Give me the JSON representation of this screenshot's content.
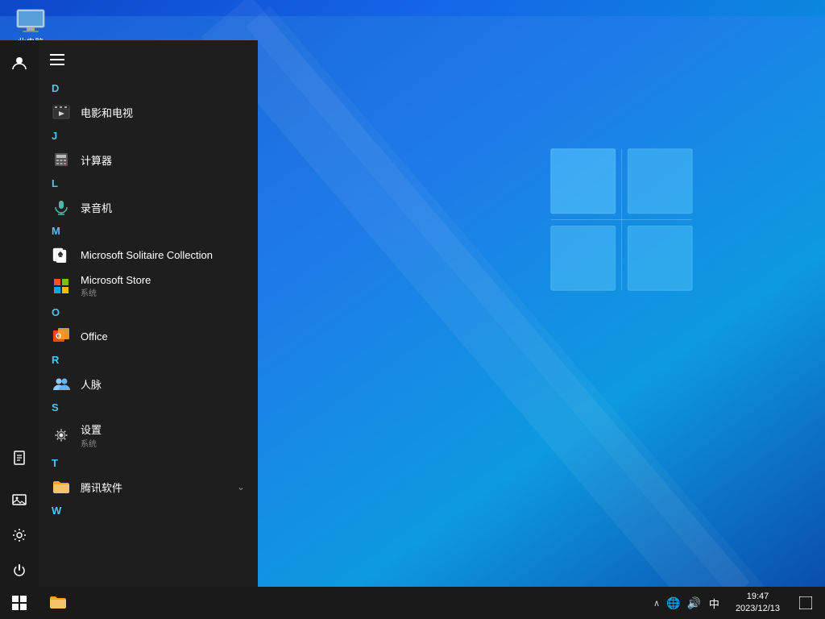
{
  "desktop": {
    "icon_label": "此电脑"
  },
  "taskbar": {
    "time": "19:47",
    "date": "2023/12/13",
    "ime": "中",
    "start_label": "Start",
    "notification_label": "Notifications"
  },
  "start_menu": {
    "hamburger_label": "☰",
    "sidebar_items": [
      {
        "id": "user",
        "icon": "👤",
        "label": "User"
      },
      {
        "id": "document",
        "icon": "📄",
        "label": "Documents"
      },
      {
        "id": "photos",
        "icon": "🖼",
        "label": "Photos"
      },
      {
        "id": "settings",
        "icon": "⚙",
        "label": "Settings"
      },
      {
        "id": "power",
        "icon": "⏻",
        "label": "Power"
      }
    ],
    "sections": [
      {
        "letter": "D",
        "apps": [
          {
            "id": "movies",
            "name": "电影和电视",
            "subtitle": "",
            "icon_type": "movies"
          }
        ]
      },
      {
        "letter": "J",
        "apps": [
          {
            "id": "calculator",
            "name": "计算器",
            "subtitle": "",
            "icon_type": "calc"
          }
        ]
      },
      {
        "letter": "L",
        "apps": [
          {
            "id": "recorder",
            "name": "录音机",
            "subtitle": "",
            "icon_type": "mic"
          }
        ]
      },
      {
        "letter": "M",
        "apps": [
          {
            "id": "solitaire",
            "name": "Microsoft Solitaire Collection",
            "subtitle": "",
            "icon_type": "solitaire"
          },
          {
            "id": "store",
            "name": "Microsoft Store",
            "subtitle": "系统",
            "icon_type": "store"
          }
        ]
      },
      {
        "letter": "O",
        "apps": [
          {
            "id": "office",
            "name": "Office",
            "subtitle": "",
            "icon_type": "office"
          }
        ]
      },
      {
        "letter": "R",
        "apps": [
          {
            "id": "contacts",
            "name": "人脉",
            "subtitle": "",
            "icon_type": "contacts"
          }
        ]
      },
      {
        "letter": "S",
        "apps": [
          {
            "id": "settings-app",
            "name": "设置",
            "subtitle": "系统",
            "icon_type": "settings"
          }
        ]
      },
      {
        "letter": "T",
        "apps": [
          {
            "id": "tencent",
            "name": "腾讯软件",
            "subtitle": "",
            "icon_type": "folder",
            "has_arrow": true
          }
        ]
      },
      {
        "letter": "W",
        "apps": []
      }
    ]
  }
}
